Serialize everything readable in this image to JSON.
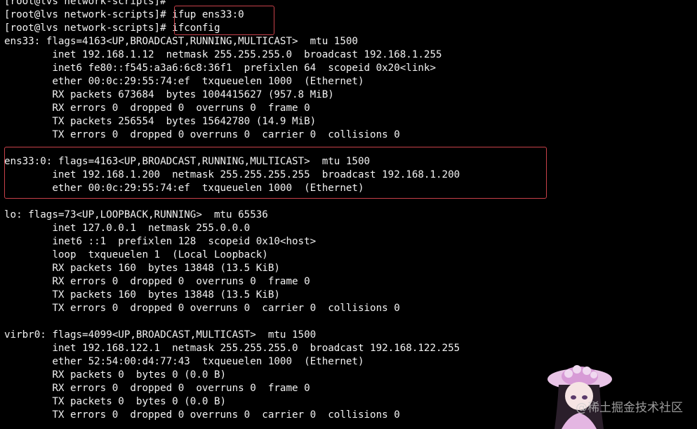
{
  "terminal": {
    "lines": [
      "[root@lvs network-scripts]#",
      "[root@lvs network-scripts]# ifup ens33:0",
      "[root@lvs network-scripts]# ifconfig",
      "ens33: flags=4163<UP,BROADCAST,RUNNING,MULTICAST>  mtu 1500",
      "        inet 192.168.1.12  netmask 255.255.255.0  broadcast 192.168.1.255",
      "        inet6 fe80::f545:a3a6:6c8:36f1  prefixlen 64  scopeid 0x20<link>",
      "        ether 00:0c:29:55:74:ef  txqueuelen 1000  (Ethernet)",
      "        RX packets 673684  bytes 1004415627 (957.8 MiB)",
      "        RX errors 0  dropped 0  overruns 0  frame 0",
      "        TX packets 256554  bytes 15642780 (14.9 MiB)",
      "        TX errors 0  dropped 0 overruns 0  carrier 0  collisions 0",
      "",
      "ens33:0: flags=4163<UP,BROADCAST,RUNNING,MULTICAST>  mtu 1500",
      "        inet 192.168.1.200  netmask 255.255.255.255  broadcast 192.168.1.200",
      "        ether 00:0c:29:55:74:ef  txqueuelen 1000  (Ethernet)",
      "",
      "lo: flags=73<UP,LOOPBACK,RUNNING>  mtu 65536",
      "        inet 127.0.0.1  netmask 255.0.0.0",
      "        inet6 ::1  prefixlen 128  scopeid 0x10<host>",
      "        loop  txqueuelen 1  (Local Loopback)",
      "        RX packets 160  bytes 13848 (13.5 KiB)",
      "        RX errors 0  dropped 0  overruns 0  frame 0",
      "        TX packets 160  bytes 13848 (13.5 KiB)",
      "        TX errors 0  dropped 0 overruns 0  carrier 0  collisions 0",
      "",
      "virbr0: flags=4099<UP,BROADCAST,MULTICAST>  mtu 1500",
      "        inet 192.168.122.1  netmask 255.255.255.0  broadcast 192.168.122.255",
      "        ether 52:54:00:d4:77:43  txqueuelen 1000  (Ethernet)",
      "        RX packets 0  bytes 0 (0.0 B)",
      "        RX errors 0  dropped 0  overruns 0  frame 0",
      "        TX packets 0  bytes 0 (0.0 B)",
      "        TX errors 0  dropped 0 overruns 0  carrier 0  collisions 0"
    ]
  },
  "watermark": {
    "text": "@稀土掘金技术社区"
  },
  "colors": {
    "background": "#000000",
    "text": "#f2f2f2",
    "highlight_border": "#c8414a"
  },
  "icons": {
    "mascot": "anime-girl-sticker"
  }
}
